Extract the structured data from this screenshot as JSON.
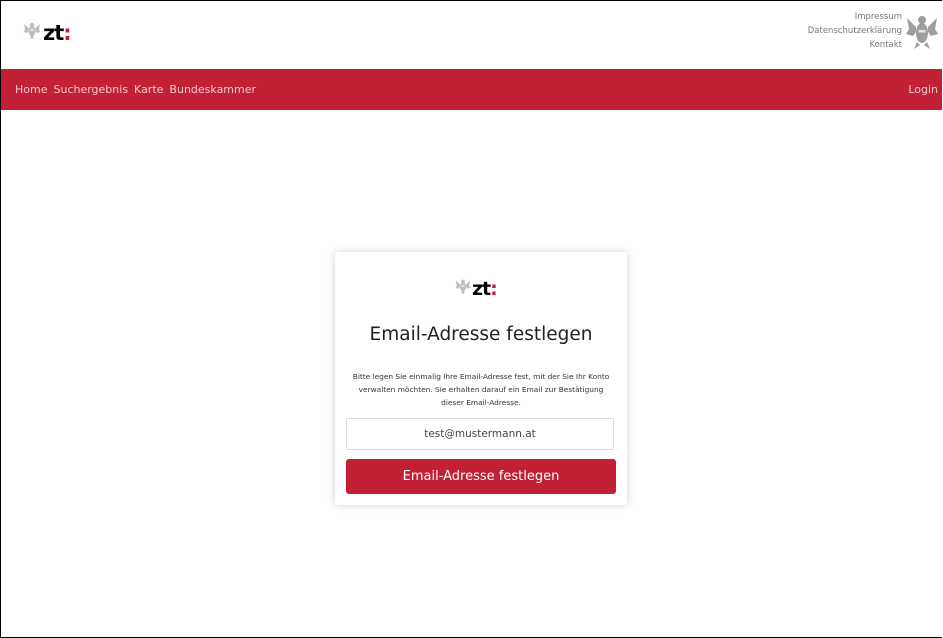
{
  "header": {
    "logo_text": "zt",
    "logo_colon": ":",
    "links": [
      "Impressum",
      "Datenschutzerklärung",
      "Kontakt"
    ]
  },
  "nav": {
    "items": [
      "Home",
      "Suchergebnis",
      "Karte",
      "Bundeskammer"
    ],
    "login": "Login"
  },
  "card": {
    "logo_text": "zt",
    "logo_colon": ":",
    "title": "Email-Adresse festlegen",
    "description": "Bitte legen Sie einmalig Ihre Email-Adresse fest, mit der Sie Ihr Konto verwalten möchten. Sie erhalten darauf ein Email zur Bestätigung dieser Email-Adresse.",
    "email_value": "test@mustermann.at",
    "submit_label": "Email-Adresse festlegen"
  },
  "colors": {
    "brand_red": "#c22033",
    "nav_text": "#f3c9cf"
  },
  "icons": {
    "logo_emblem": "austrian-eagle-icon",
    "top_emblem": "austrian-eagle-icon"
  }
}
